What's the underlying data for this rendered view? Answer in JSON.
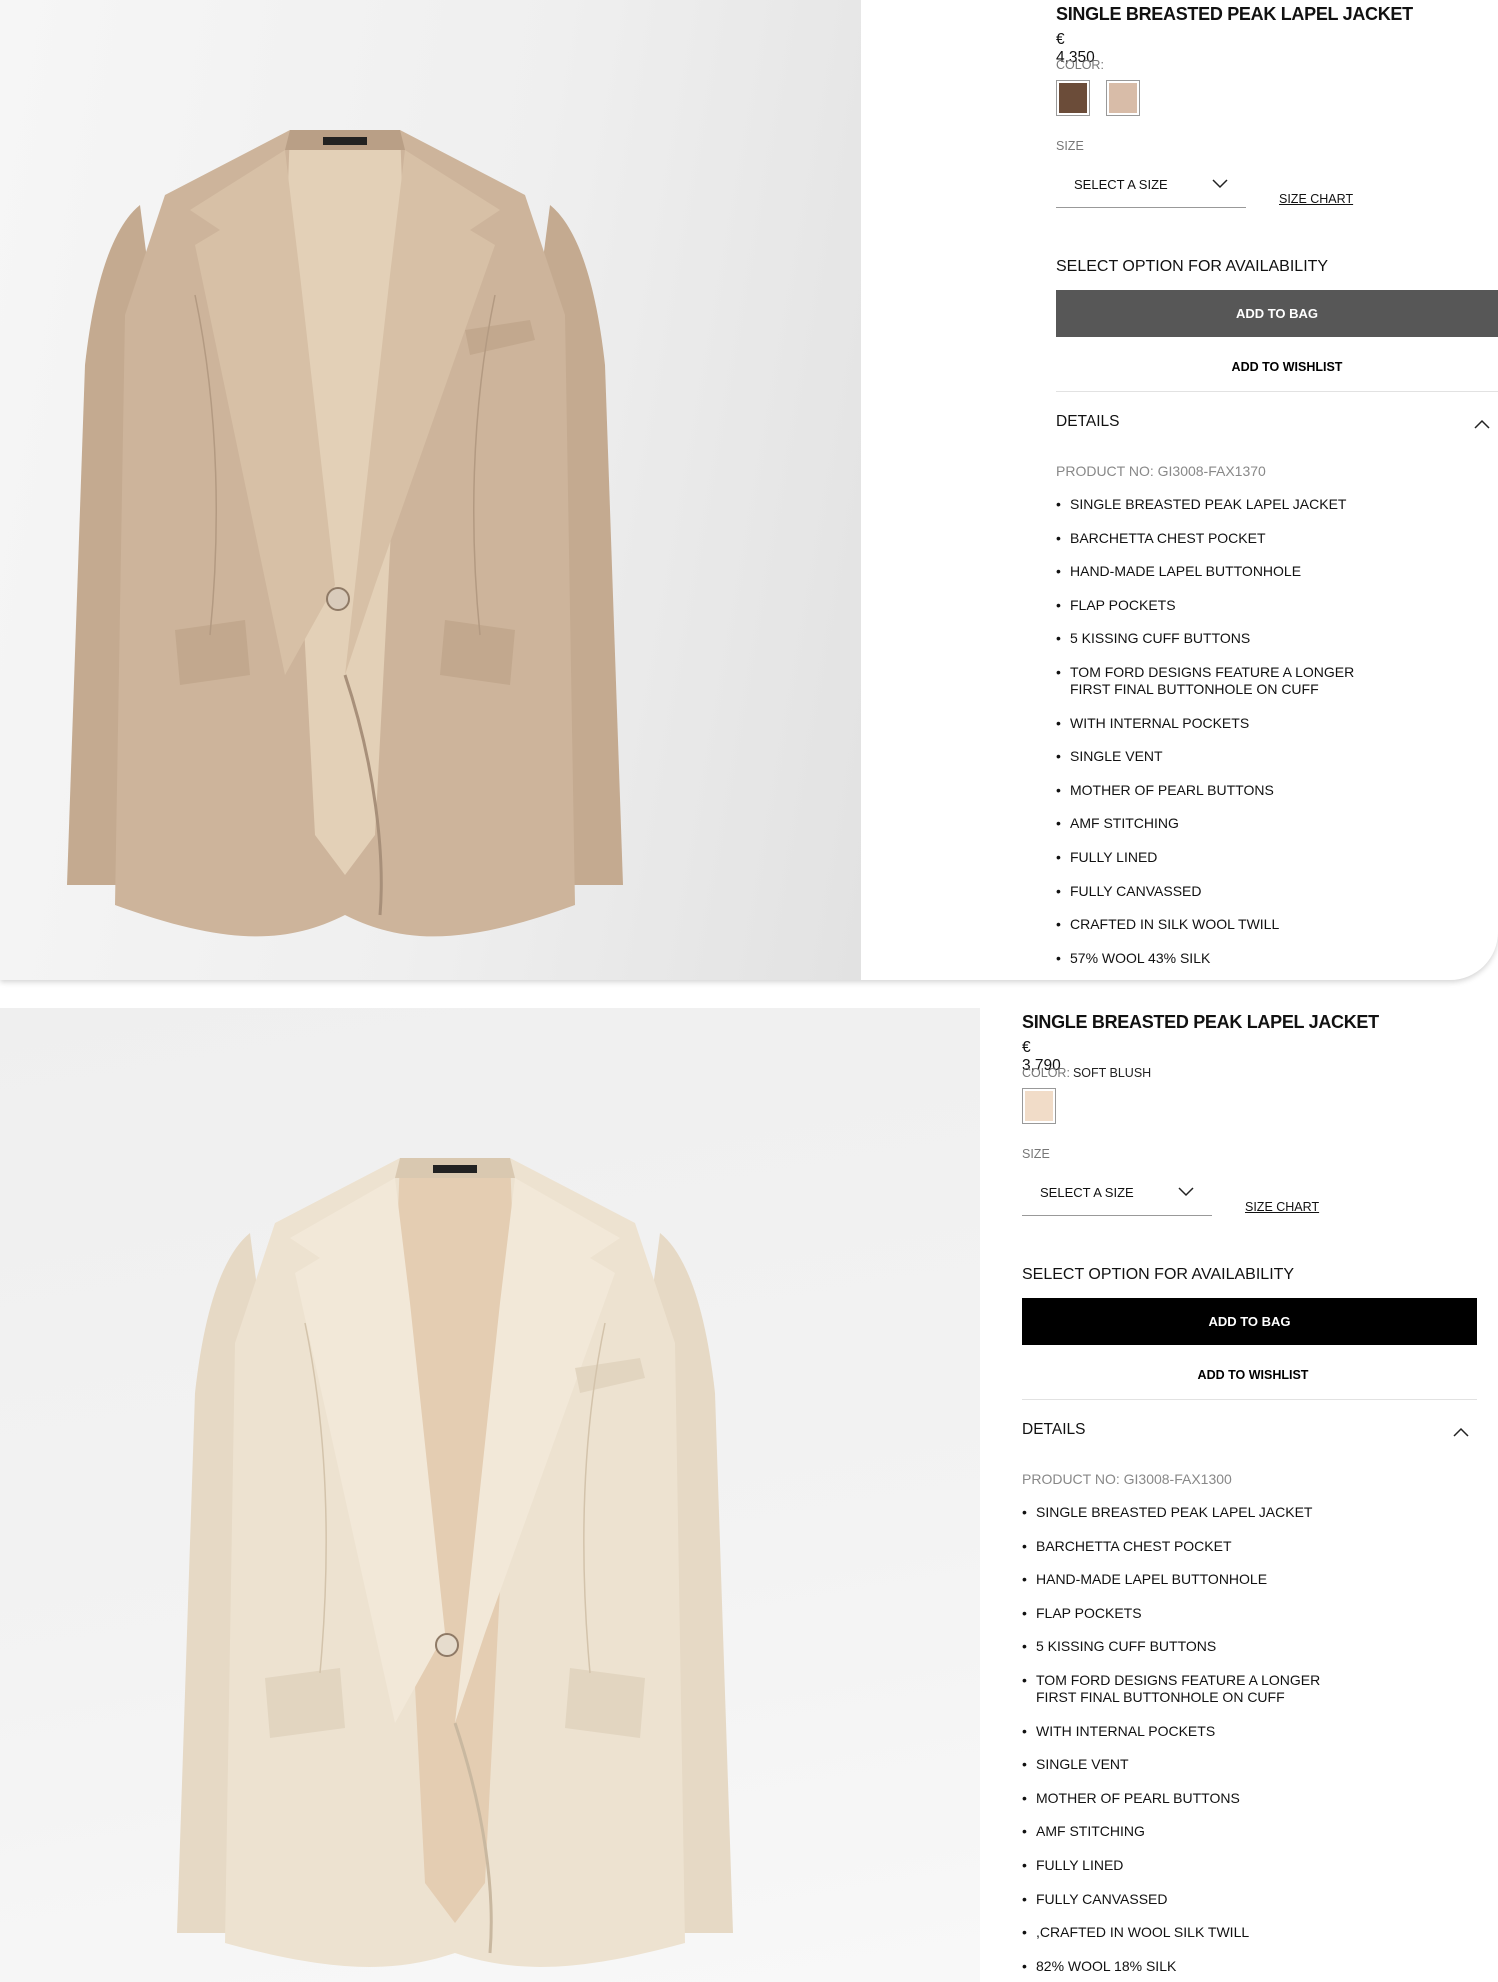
{
  "panels": [
    {
      "product": {
        "title": "SINGLE BREASTED PEAK LAPEL JACKET",
        "price": "€ 4,350",
        "color_label": "COLOR:",
        "color_name": "",
        "swatches": [
          {
            "name": "brown",
            "color": "#6b4c39"
          },
          {
            "name": "beige",
            "color": "#d8bca8"
          }
        ],
        "size_label": "SIZE",
        "size_select": "SELECT A SIZE",
        "size_chart": "SIZE CHART",
        "availability": "SELECT OPTION FOR AVAILABILITY",
        "add_to_bag": "ADD TO BAG",
        "add_to_wishlist": "ADD TO WISHLIST",
        "details_title": "DETAILS",
        "product_no": "PRODUCT NO: GI3008-FAX1370",
        "details": [
          "SINGLE BREASTED PEAK LAPEL JACKET",
          "BARCHETTA CHEST POCKET",
          "HAND-MADE LAPEL BUTTONHOLE",
          "FLAP POCKETS",
          "5 KISSING CUFF BUTTONS",
          "TOM FORD DESIGNS FEATURE A LONGER FIRST FINAL BUTTONHOLE ON CUFF",
          "WITH INTERNAL POCKETS",
          "SINGLE VENT",
          "MOTHER OF PEARL BUTTONS",
          "AMF STITCHING",
          "FULLY LINED",
          "FULLY CANVASSED",
          "CRAFTED IN SILK WOOL TWILL",
          "57% WOOL 43% SILK"
        ]
      },
      "image": {
        "jacket_color": "#cdb49b",
        "lapel_color": "#d7c0a6",
        "lining_color": "#e3d0b7",
        "shade_color": "#a8907a"
      }
    },
    {
      "product": {
        "title": "SINGLE BREASTED PEAK LAPEL JACKET",
        "price": "€ 3,790",
        "color_label": "COLOR:",
        "color_name": "SOFT BLUSH",
        "swatches": [
          {
            "name": "soft-blush",
            "color": "#f1dcc8"
          }
        ],
        "size_label": "SIZE",
        "size_select": "SELECT A SIZE",
        "size_chart": "SIZE CHART",
        "availability": "SELECT OPTION FOR AVAILABILITY",
        "add_to_bag": "ADD TO BAG",
        "add_to_wishlist": "ADD TO WISHLIST",
        "details_title": "DETAILS",
        "product_no": "PRODUCT NO: GI3008-FAX1300",
        "details": [
          "SINGLE BREASTED PEAK LAPEL JACKET",
          "BARCHETTA CHEST POCKET",
          "HAND-MADE LAPEL BUTTONHOLE",
          "FLAP POCKETS",
          "5 KISSING CUFF BUTTONS",
          "TOM FORD DESIGNS FEATURE A LONGER FIRST FINAL BUTTONHOLE ON CUFF",
          "WITH INTERNAL POCKETS",
          "SINGLE VENT",
          "MOTHER OF PEARL BUTTONS",
          "AMF STITCHING",
          "FULLY LINED",
          "FULLY CANVASSED",
          ",CRAFTED IN WOOL SILK TWILL",
          "82% WOOL 18% SILK"
        ]
      },
      "image": {
        "jacket_color": "#ede2d0",
        "lapel_color": "#f2e8d8",
        "lining_color": "#e4cdb2",
        "shade_color": "#c9b8a0"
      }
    }
  ]
}
